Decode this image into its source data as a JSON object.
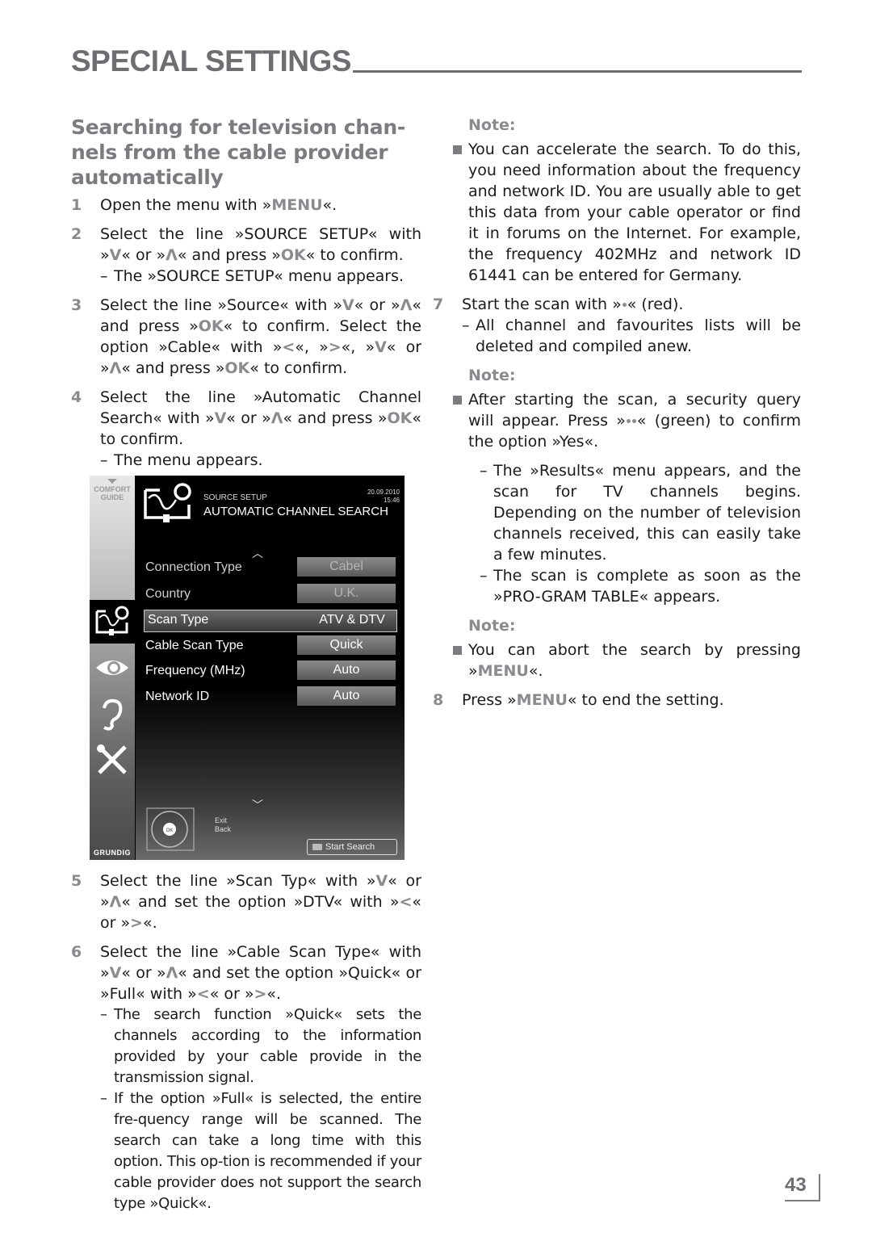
{
  "header": {
    "title": "SPECIAL SETTINGS"
  },
  "section": {
    "heading": "Searching for television chan-nels from the cable provider automatically"
  },
  "keys": {
    "menu": "MENU",
    "ok": "OK",
    "down": "V",
    "up": "Λ",
    "left": "<",
    "right": ">"
  },
  "left_steps": {
    "s1": {
      "num": "1",
      "pre": "Open the menu with »",
      "post": "«."
    },
    "s2": {
      "num": "2",
      "a": "Select the line »SOURCE SETUP« with »",
      "b": "« or »",
      "c": "« and press »",
      "d": "« to confirm.",
      "sub": "The »SOURCE SETUP« menu appears."
    },
    "s3": {
      "num": "3",
      "a": "Select the line »Source« with »",
      "b": "« or »",
      "c": "« and press »",
      "d": "« to confirm.",
      "e": "Select the option »Cable« with »",
      "f": "«, »",
      "g": "«, »",
      "h": "« or »",
      "i": "« and press »",
      "j": "« to confirm."
    },
    "s4": {
      "num": "4",
      "a": "Select the line »Automatic Channel Search« with »",
      "b": "« or »",
      "c": "« and press »",
      "d": "« to confirm.",
      "sub": "The menu appears."
    },
    "s5": {
      "num": "5",
      "a": "Select the line »Scan Typ« with »",
      "b": "« or »",
      "c": "« and set the option »DTV« with »",
      "d": "« or »",
      "e": "«."
    },
    "s6": {
      "num": "6",
      "a": "Select the line »Cable Scan Type« with »",
      "b": "« or »",
      "c": "« and set the option »Quick« or »Full« with »",
      "d": "« or »",
      "e": "«.",
      "sub1": "The search function »Quick« sets the channels according to the information provided by your cable provide in the transmission signal.",
      "sub2": "If the option »Full« is selected, the entire fre-quency range will be scanned. The search can take a long time with this option. This op-tion is recommended if your cable provider does not support the search type »Quick«."
    }
  },
  "tv_menu": {
    "comfort_guide": "COMFORT GUIDE",
    "brand": "GRUNDIG",
    "subtitle": "SOURCE SETUP",
    "title": "AUTOMATIC CHANNEL SEARCH",
    "date": "20.09.2010",
    "time": "15:46",
    "rows": [
      {
        "label": "Connection Type",
        "value": "Cabel"
      },
      {
        "label": "Country",
        "value": "U.K."
      },
      {
        "label": "Scan Type",
        "value": "ATV & DTV"
      },
      {
        "label": "Cable Scan Type",
        "value": "Quick"
      },
      {
        "label": "Frequency (MHz)",
        "value": "Auto"
      },
      {
        "label": "Network ID",
        "value": "Auto"
      }
    ],
    "remote_ok": "OK",
    "exit": "Exit",
    "back": "Back",
    "start_search": "Start Search"
  },
  "right": {
    "note_label": "Note:",
    "note1": "You can accelerate the search. To do this, you need information about the frequency and network ID. You are usually able to get this data from your cable operator or find it in forums on the Internet. For example, the frequency 402MHz and network ID 61441 can be entered for Germany.",
    "s7": {
      "num": "7",
      "a": "Start the scan with »",
      "b": "« (red).",
      "sub": "All channel and favourites lists will be deleted and compiled anew."
    },
    "note2_a": "After starting the scan, a security query will appear. Press »",
    "note2_b": "« (green) to confirm the option »Yes«.",
    "sub_results": "The »Results« menu appears, and the scan for TV channels begins. Depending on the number of television channels received, this can easily take a few minutes.",
    "sub_complete": "The scan is complete as soon as the »PRO-GRAM TABLE« appears.",
    "note3_a": "You can abort the search by pressing »",
    "note3_b": "«.",
    "s8": {
      "num": "8",
      "a": "Press »",
      "b": "« to end the setting."
    }
  },
  "footer": {
    "page_number": "43"
  }
}
